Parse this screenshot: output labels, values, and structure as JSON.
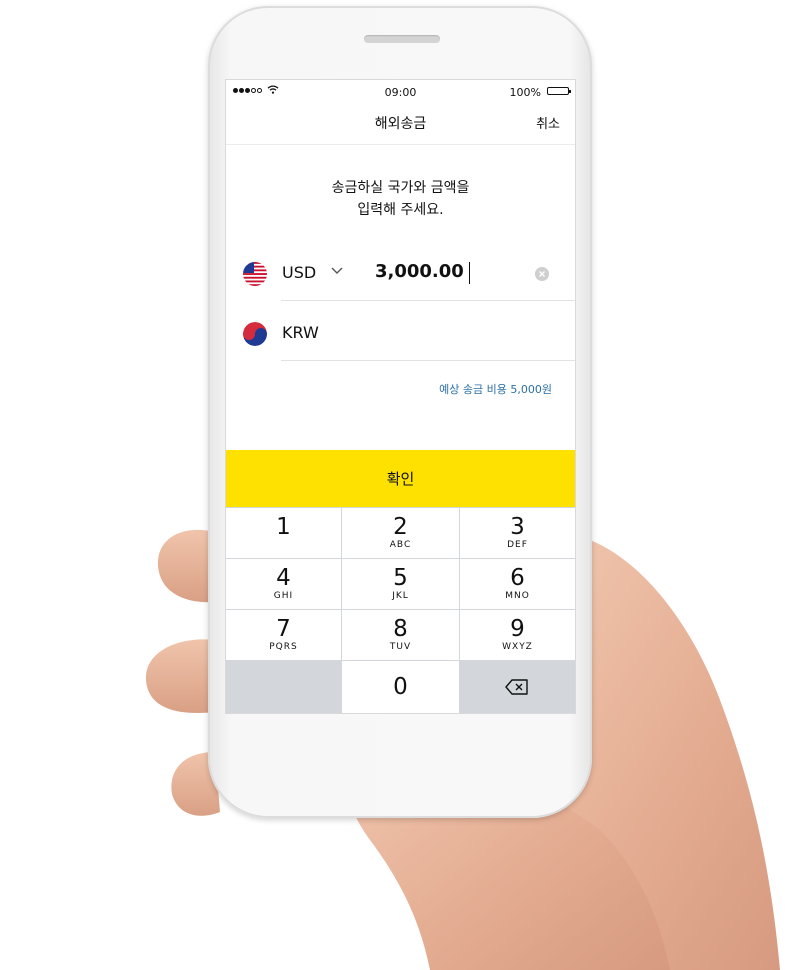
{
  "status_bar": {
    "time": "09:00",
    "battery": "100%"
  },
  "navbar": {
    "title": "해외송금",
    "cancel_label": "취소"
  },
  "instruction": {
    "line1": "송금하실 국가와 금액을",
    "line2": "입력해 주세요."
  },
  "send": {
    "currency": "USD",
    "amount": "3,000.00",
    "flag_icon": "us-flag-icon"
  },
  "receive": {
    "currency": "KRW",
    "flag_icon": "kr-flag-icon"
  },
  "fee_text": "예상 송금 비용 5,000원",
  "confirm_label": "확인",
  "keypad": {
    "keys": [
      {
        "num": "1",
        "letters": ""
      },
      {
        "num": "2",
        "letters": "ABC"
      },
      {
        "num": "3",
        "letters": "DEF"
      },
      {
        "num": "4",
        "letters": "GHI"
      },
      {
        "num": "5",
        "letters": "JKL"
      },
      {
        "num": "6",
        "letters": "MNO"
      },
      {
        "num": "7",
        "letters": "PQRS"
      },
      {
        "num": "8",
        "letters": "TUV"
      },
      {
        "num": "9",
        "letters": "WXYZ"
      },
      {
        "num": "0",
        "letters": ""
      }
    ],
    "backspace_icon": "backspace-icon"
  },
  "colors": {
    "accent": "#ffe100",
    "link": "#2d6fa5",
    "keypad_bg": "#d3d6db"
  }
}
